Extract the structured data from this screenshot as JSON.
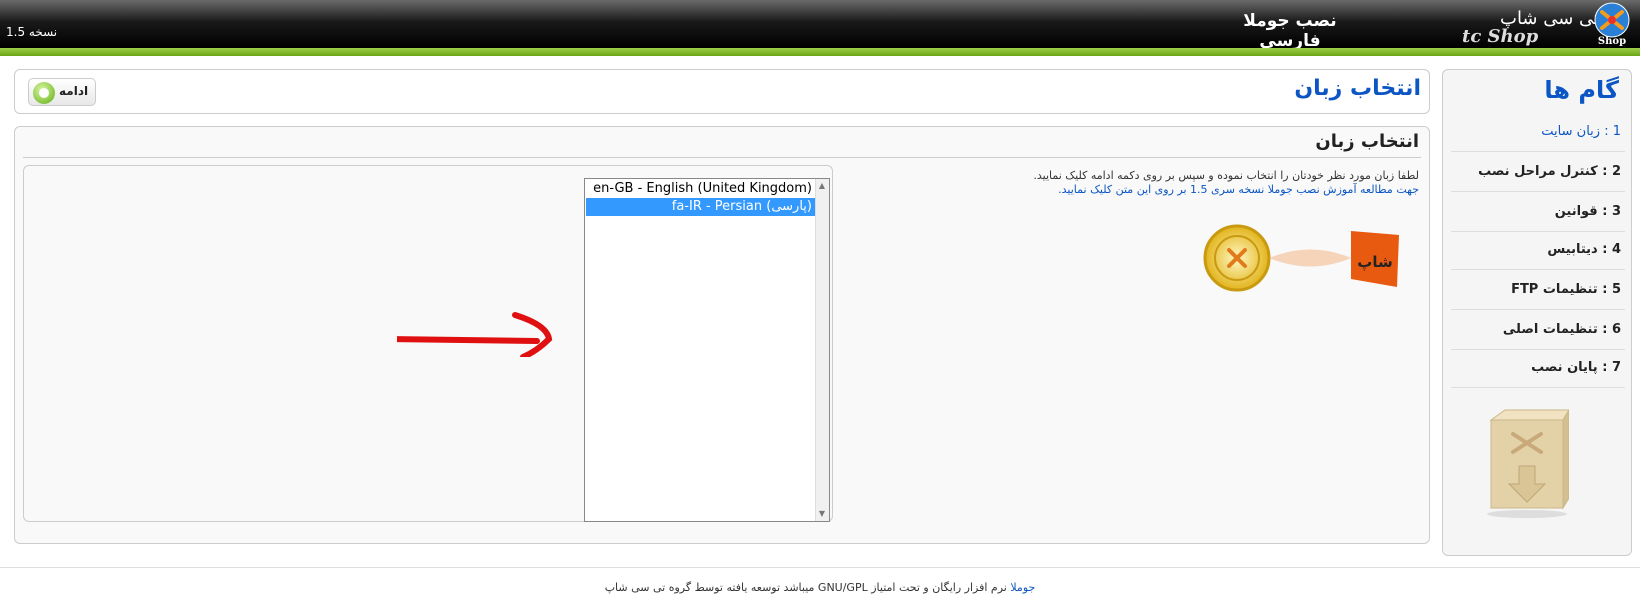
{
  "header": {
    "title": "نصب جوملا فارسی",
    "version": "نسخه 1.5",
    "brand": "تی سی شاپ",
    "brand_sub": "tc Shop",
    "logo_icon": "joomla-logo-icon"
  },
  "sidebar": {
    "title": "گام ها",
    "steps": [
      {
        "label": "1 : زبان سایت"
      },
      {
        "label": "2 : کنترل مراحل نصب"
      },
      {
        "label": "3 : قوانین"
      },
      {
        "label": "4 : دیتابیس"
      },
      {
        "label": "5 : تنظیمات FTP"
      },
      {
        "label": "6 : تنظیمات اصلی"
      },
      {
        "label": "7 : پایان نصب"
      }
    ],
    "box_icon": "install-box-icon"
  },
  "top_panel": {
    "page_title": "انتخاب زبان",
    "next_label": "ادامه",
    "next_icon": "forward-circle-icon"
  },
  "main_panel": {
    "section_title": "انتخاب زبان",
    "instruction": "لطفا زبان مورد نظر خودتان را انتخاب نموده و سپس بر روی دکمه ادامه کلیک نمایید.",
    "tutorial_link": "جهت مطالعه آموزش نصب جوملا نسخه سری 1.5 بر روی این متن کلیک نمایید.",
    "languages": [
      {
        "label": "en-GB - English (United Kingdom)",
        "selected": false
      },
      {
        "label": "fa-IR - Persian (پارسی)",
        "selected": true
      }
    ]
  },
  "footer": {
    "link": "جوملا",
    "text": " نرم افزار رایگان و تحت امتیاز GNU/GPL میباشد توسعه یافته توسط گروه تی سی شاپ"
  },
  "colors": {
    "accent": "#0b55c4",
    "green_bar": "#7ab829",
    "selected_option": "#3399ff",
    "arrow": "#e01010"
  }
}
